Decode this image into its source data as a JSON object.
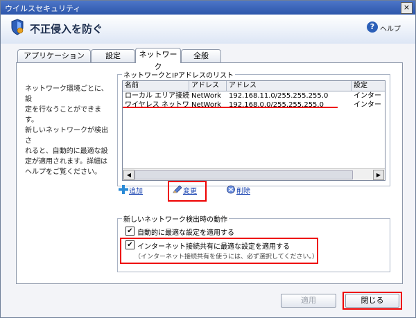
{
  "window": {
    "title": "ウイルスセキュリティ",
    "close_label": "×"
  },
  "header": {
    "title": "不正侵入を防ぐ",
    "help_label": "ヘルプ",
    "help_icon_glyph": "?"
  },
  "tabs": [
    {
      "label": "アプリケーション",
      "active": false
    },
    {
      "label": "設定",
      "active": false
    },
    {
      "label": "ネットワーク",
      "active": true
    },
    {
      "label": "全般",
      "active": false
    }
  ],
  "description": {
    "lines": [
      "ネットワーク環境ごとに、設",
      "定を行なうことができます。",
      "新しいネットワークが検出さ",
      "れると、自動的に最適な設",
      "定が適用されます。詳細は",
      "ヘルプをご覧ください。"
    ]
  },
  "network_list": {
    "legend": "ネットワークとIPアドレスのリスト",
    "columns": [
      "名前",
      "アドレス",
      "アドレス",
      "設定"
    ],
    "rows": [
      {
        "name": "ローカル エリア接続",
        "type": "NetWork",
        "address": "192.168.11.0/255.255.255.0",
        "setting": "インター",
        "selected": true
      },
      {
        "name": "ワイヤレス ネットワ...",
        "type": "NetWork",
        "address": "192.168.0.0/255.255.255.0",
        "setting": "インター",
        "selected": false
      }
    ],
    "scroll_left": "◀",
    "scroll_right": "▶"
  },
  "actions": {
    "add_label": "追加",
    "change_label": "変更",
    "delete_label": "削除"
  },
  "detection": {
    "legend": "新しいネットワーク検出時の動作",
    "auto_optimal_label": "自動的に最適な設定を適用する",
    "auto_optimal_checked": true,
    "ics_label": "インターネット接続共有に最適な設定を適用する",
    "ics_checked": true,
    "ics_note": "（インターネット接続共有を使うには、必ず選択してください。）",
    "check_glyph": "✔"
  },
  "footer": {
    "apply_label": "適用",
    "close_label": "閉じる"
  },
  "colors": {
    "accent": "#2d56ab",
    "highlight": "#e00000",
    "link": "#1540b0"
  }
}
